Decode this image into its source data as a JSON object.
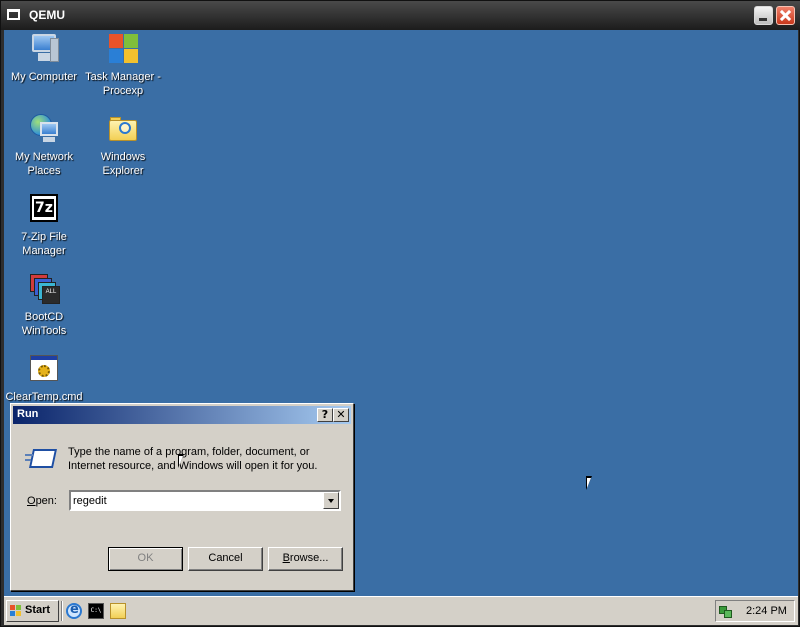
{
  "host_window": {
    "title": "QEMU"
  },
  "desktop": {
    "icons": [
      {
        "label": "My Computer",
        "icon": "computer-icon"
      },
      {
        "label": "Task Manager -\nProcexp",
        "icon": "task-manager-icon"
      },
      {
        "label": "My Network\nPlaces",
        "icon": "network-places-icon"
      },
      {
        "label": "Windows\nExplorer",
        "icon": "windows-explorer-icon"
      },
      {
        "label": "7-Zip File\nManager",
        "icon": "7zip-icon"
      },
      {
        "label": "BootCD\nWinTools",
        "icon": "bootcd-icon"
      },
      {
        "label": "ClearTemp.cmd",
        "icon": "cmd-script-icon"
      }
    ],
    "background_color": "#3a6ea5"
  },
  "run_dialog": {
    "title": "Run",
    "help_label": "?",
    "close_label": "✕",
    "description": "Type the name of a program, folder, document, or Internet resource, and Windows will open it for you.",
    "open_label_accel": "O",
    "open_label_rest": "pen:",
    "open_value": "regedit",
    "ok_label": "OK",
    "cancel_label": "Cancel",
    "browse_label_accel": "B",
    "browse_label_rest": "rowse..."
  },
  "taskbar": {
    "start_label": "Start",
    "quick_launch": [
      "internet-explorer-icon",
      "command-prompt-icon",
      "windows-explorer-icon"
    ],
    "cmd_icon_text": "C:\\",
    "clock": "2:24 PM"
  },
  "colors": {
    "title_active": "#0a246a",
    "title_gradient_end": "#a6caf0",
    "face": "#d4d0c8"
  }
}
